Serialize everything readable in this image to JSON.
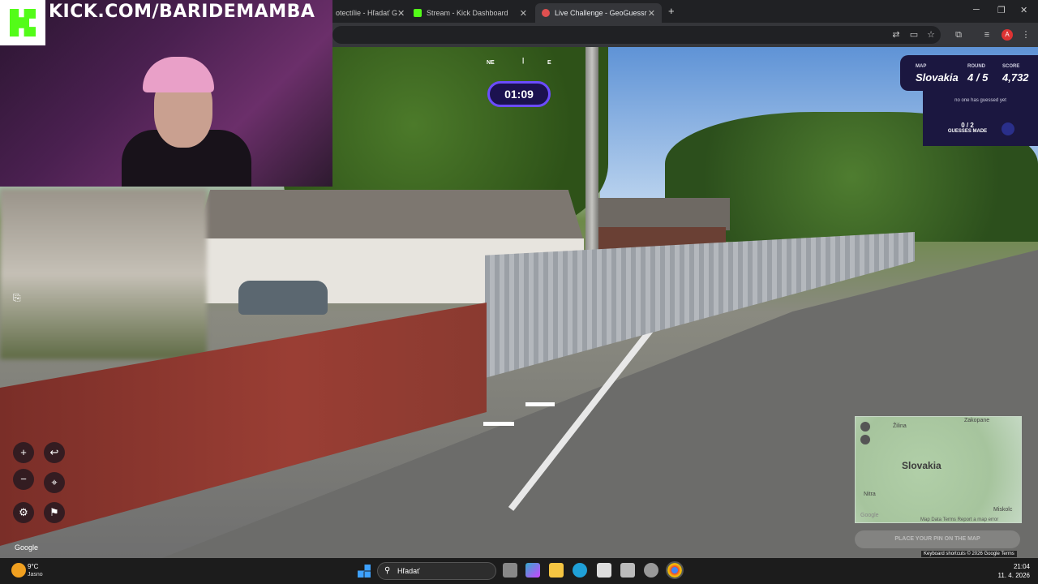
{
  "browser": {
    "tabs": [
      {
        "label": "otectílie - Hľadať G",
        "active": false
      },
      {
        "label": "Stream - Kick Dashboard",
        "active": false
      },
      {
        "label": "Live Challenge - GeoGuessr",
        "active": true
      }
    ],
    "profile_initial": "A"
  },
  "stream": {
    "channel_url": "KICK.COM/BARIDEMAMBA",
    "brand_color": "#53fc18"
  },
  "game": {
    "compass": {
      "ne": "NE",
      "e": "E"
    },
    "timer": "01:09",
    "map_label": "MAP",
    "map_value": "Slovakia",
    "round_label": "ROUND",
    "round_value": "4 / 5",
    "score_label": "SCORE",
    "score_value": "4,732",
    "guess_note": "no one has guessed yet",
    "guesses_count": "0 / 2",
    "guesses_label": "GUESSES MADE",
    "place_pin_button": "PLACE YOUR PIN ON THE MAP",
    "accent_color": "#6b4cff"
  },
  "controls": {
    "zoom_in": "+",
    "zoom_out": "−",
    "undo": "↩",
    "checkpoint": "⌖",
    "settings": "⚙",
    "flag": "⚑"
  },
  "minimap": {
    "country": "Slovakia",
    "cities": [
      "Žilina",
      "Zakopane",
      "Nitra",
      "Miskolc"
    ],
    "google_label": "Google",
    "footer": "Map Data   Terms   Report a map error"
  },
  "google_watermark": "Google",
  "attribution": {
    "keyboard": "Keyboard shortcuts",
    "data": "© 2026 Google",
    "terms": "Terms"
  },
  "taskbar": {
    "temperature": "9°C",
    "weather_desc": "Jasno",
    "search_placeholder": "Hľadať",
    "time": "21:04",
    "date": "11. 4. 2026"
  }
}
